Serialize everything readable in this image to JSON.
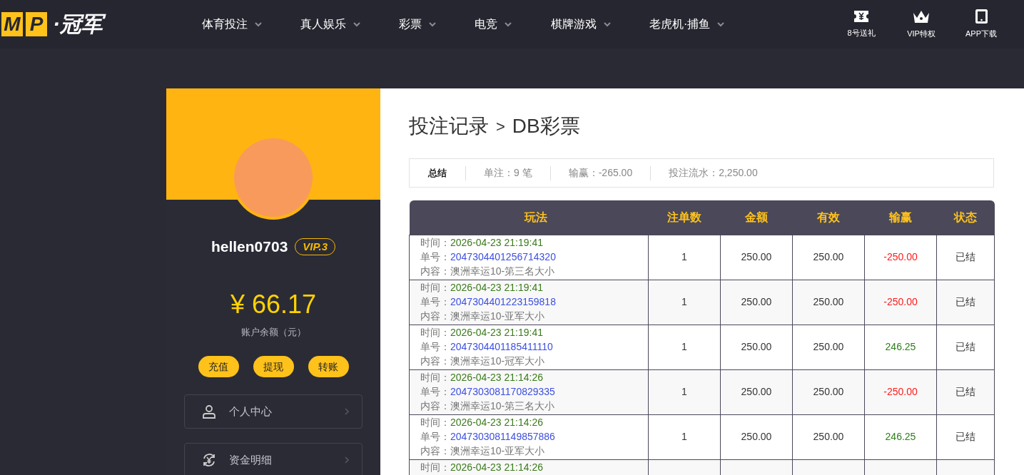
{
  "header": {
    "logo": {
      "letters": [
        "M",
        "P"
      ],
      "name": "·冠军"
    },
    "nav": [
      {
        "label": "体育投注"
      },
      {
        "label": "真人娱乐"
      },
      {
        "label": "彩票"
      },
      {
        "label": "电竞"
      },
      {
        "label": "棋牌游戏"
      },
      {
        "label": "老虎机·捕鱼"
      }
    ],
    "actions": [
      {
        "kind": "ticket",
        "label": "8号送礼"
      },
      {
        "kind": "crown",
        "label": "VIP特权"
      },
      {
        "kind": "phone",
        "label": "APP下载"
      }
    ]
  },
  "sidebar": {
    "username": "hellen0703",
    "vip": "VIP.3",
    "balance": "¥ 66.17",
    "balance_label": "账户余额（元）",
    "buttons": [
      "充值",
      "提现",
      "转账"
    ],
    "menu": [
      {
        "kind": "person",
        "label": "个人中心"
      },
      {
        "kind": "money",
        "label": "资金明细"
      }
    ]
  },
  "main": {
    "breadcrumb": [
      "投注记录",
      ">",
      "DB彩票"
    ],
    "summary": [
      {
        "kind": "title",
        "text": "总结"
      },
      {
        "kind": "stat",
        "text": "单注：9 笔"
      },
      {
        "kind": "stat",
        "text": "输赢：-265.00"
      },
      {
        "kind": "stat",
        "text": "投注流水：2,250.00"
      }
    ],
    "table": {
      "columns": [
        "玩法",
        "注单数",
        "金额",
        "有效",
        "输赢",
        "状态"
      ],
      "rows": [
        {
          "time_label": "时间：",
          "time": "2026-04-23 21:19:41",
          "no_label": "单号：",
          "no": "2047304401256714320",
          "content": "内容：澳洲幸运10-第三名大小",
          "count": "1",
          "amount": "250.00",
          "valid": "250.00",
          "result": "-250.00",
          "color": "#ff1a1a",
          "status": "已结"
        },
        {
          "time_label": "时间：",
          "time": "2026-04-23 21:19:41",
          "no_label": "单号：",
          "no": "2047304401223159818",
          "content": "内容：澳洲幸运10-亚军大小",
          "count": "1",
          "amount": "250.00",
          "valid": "250.00",
          "result": "-250.00",
          "color": "#ff1a1a",
          "status": "已结"
        },
        {
          "time_label": "时间：",
          "time": "2026-04-23 21:19:41",
          "no_label": "单号：",
          "no": "2047304401185411110",
          "content": "内容：澳洲幸运10-冠军大小",
          "count": "1",
          "amount": "250.00",
          "valid": "250.00",
          "result": "246.25",
          "color": "#2e7d1a",
          "status": "已结"
        },
        {
          "time_label": "时间：",
          "time": "2026-04-23 21:14:26",
          "no_label": "单号：",
          "no": "2047303081170829335",
          "content": "内容：澳洲幸运10-第三名大小",
          "count": "1",
          "amount": "250.00",
          "valid": "250.00",
          "result": "-250.00",
          "color": "#ff1a1a",
          "status": "已结"
        },
        {
          "time_label": "时间：",
          "time": "2026-04-23 21:14:26",
          "no_label": "单号：",
          "no": "2047303081149857886",
          "content": "内容：澳洲幸运10-亚军大小",
          "count": "1",
          "amount": "250.00",
          "valid": "250.00",
          "result": "246.25",
          "color": "#2e7d1a",
          "status": "已结"
        },
        {
          "time_label": "时间：",
          "time": "2026-04-23 21:14:26"
        }
      ]
    }
  }
}
